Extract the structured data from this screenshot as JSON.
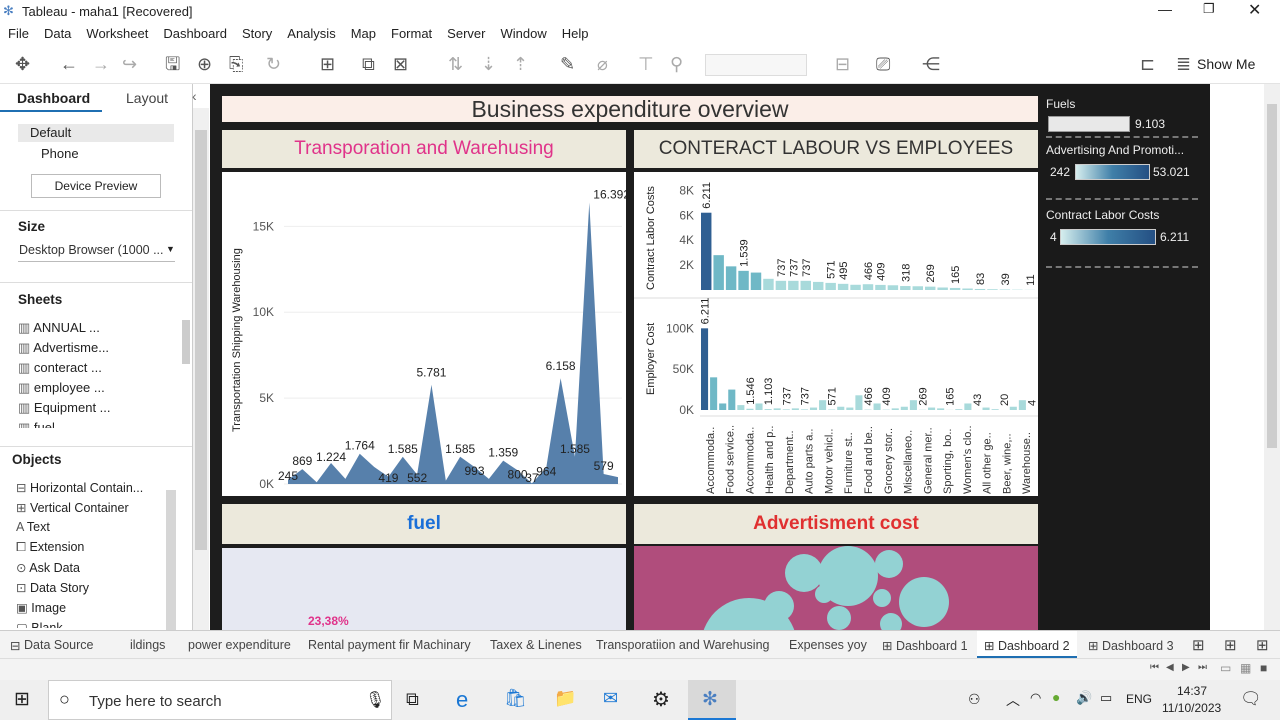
{
  "window": {
    "title": "Tableau - maha1 [Recovered]"
  },
  "menu": [
    "File",
    "Data",
    "Worksheet",
    "Dashboard",
    "Story",
    "Analysis",
    "Map",
    "Format",
    "Server",
    "Window",
    "Help"
  ],
  "toolbar": {
    "show_me": "Show Me"
  },
  "left_panel": {
    "tab_dashboard": "Dashboard",
    "tab_layout": "Layout",
    "devices": [
      "Default",
      "Phone"
    ],
    "device_preview": "Device Preview",
    "size_title": "Size",
    "size_value": "Desktop Browser (1000 ...",
    "sheets_title": "Sheets",
    "sheets": [
      "ANNUAL ...",
      "Advertisme...",
      "conteract ...",
      "employee ...",
      "Equipment ...",
      "fuel"
    ],
    "objects_title": "Objects",
    "objects": [
      "Horizontal Contain...",
      "Vertical Container",
      "Text",
      "Extension",
      "Ask Data",
      "Data Story",
      "Image",
      "Blank"
    ]
  },
  "dashboard": {
    "title": "Business expenditure overview",
    "panels": {
      "transport": "Transporation and Warehusing",
      "labour": "CONTERACT LABOUR VS EMPLOYEES",
      "fuel": "fuel",
      "advert": "Advertisment cost"
    },
    "fuel_pct": "23,38%"
  },
  "legends": {
    "fuels": {
      "title": "Fuels",
      "value": "9.103"
    },
    "advert": {
      "title": "Advertising And Promoti...",
      "min": "242",
      "max": "53.021"
    },
    "contract": {
      "title": "Contract Labor Costs",
      "min": "4",
      "max": "6.211"
    }
  },
  "chart_data": [
    {
      "type": "area",
      "title": "Transporation and Warehusing",
      "ylabel": "Transportation Shipping Warehousing",
      "ylim": [
        0,
        17000
      ],
      "yticks": [
        "0K",
        "5K",
        "10K",
        "15K"
      ],
      "values": [
        245,
        869,
        100,
        1224,
        300,
        1764,
        1000,
        419,
        1585,
        552,
        5781,
        200,
        1585,
        993,
        300,
        1359,
        800,
        37,
        964,
        6158,
        1585,
        16392,
        579,
        400
      ],
      "labels": [
        "245",
        "869",
        "1.224",
        "1.764",
        "419",
        "1.585",
        "552",
        "5.781",
        "1.585",
        "993",
        "1.359",
        "800",
        "37",
        "964",
        "6.158",
        "1.585",
        "16.392",
        "579"
      ]
    },
    {
      "type": "bar",
      "title": "CONTERACT LABOUR VS EMPLOYEES",
      "categories": [
        "Accommoda..",
        "Food service..",
        "Accommoda..",
        "Health and p..",
        "Department..",
        "Auto parts a..",
        "Motor vehicl..",
        "Furniture st..",
        "Food and be..",
        "Grocery stor..",
        "Miscellaneo..",
        "General mer..",
        "Sporting, bo..",
        "Women's clo..",
        "All other ge..",
        "Beer, wine,..",
        "Warehouse.."
      ],
      "series": [
        {
          "name": "Contract Labor Costs",
          "ylim": [
            0,
            9000
          ],
          "yticks": [
            "2K",
            "4K",
            "6K",
            "8K"
          ],
          "values": [
            6211,
            2800,
            1900,
            1539,
            1400,
            900,
            737,
            737,
            737,
            650,
            571,
            495,
            420,
            466,
            409,
            380,
            318,
            300,
            269,
            200,
            165,
            120,
            83,
            60,
            39,
            25,
            11
          ],
          "labels": [
            "6.211",
            "1.539",
            "737",
            "737",
            "737",
            "571",
            "495",
            "466",
            "409",
            "318",
            "269",
            "165",
            "83",
            "39",
            "11"
          ]
        },
        {
          "name": "Employer Cost",
          "ylim": [
            0,
            120000
          ],
          "yticks": [
            "0K",
            "50K",
            "100K"
          ],
          "values": [
            100000,
            40000,
            8000,
            25000,
            6000,
            1546,
            8000,
            1103,
            2000,
            737,
            2000,
            737,
            3000,
            12000,
            571,
            4000,
            3000,
            18000,
            466,
            8000,
            409,
            2000,
            4000,
            12000,
            269,
            3000,
            2000,
            165,
            1000,
            8000,
            43,
            3000,
            1000,
            20,
            4000,
            12000,
            4
          ],
          "labels": [
            "6.211",
            "1.546",
            "1.103",
            "737",
            "737",
            "571",
            "466",
            "409",
            "269",
            "165",
            "43",
            "20",
            "4"
          ]
        }
      ]
    }
  ]
}
